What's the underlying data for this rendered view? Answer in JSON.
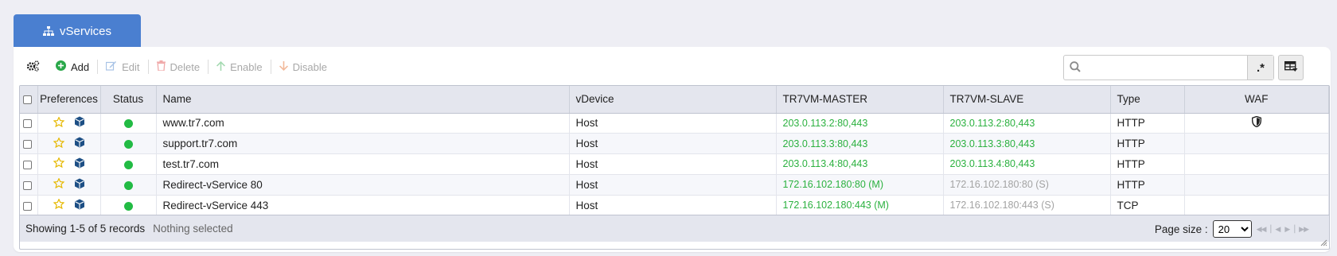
{
  "tab": {
    "label": "vServices"
  },
  "toolbar": {
    "add": "Add",
    "edit": "Edit",
    "delete": "Delete",
    "enable": "Enable",
    "disable": "Disable"
  },
  "search": {
    "value": "",
    "regex_label": ".*"
  },
  "columns": {
    "preferences": "Preferences",
    "status": "Status",
    "name": "Name",
    "vdevice": "vDevice",
    "master": "TR7VM-MASTER",
    "slave": "TR7VM-SLAVE",
    "type": "Type",
    "waf": "WAF"
  },
  "rows": [
    {
      "name": "www.tr7.com",
      "vdevice": "Host",
      "master": "203.0.113.2:80,443",
      "slave": "203.0.113.2:80,443",
      "type": "HTTP",
      "waf": true
    },
    {
      "name": "support.tr7.com",
      "vdevice": "Host",
      "master": "203.0.113.3:80,443",
      "slave": "203.0.113.3:80,443",
      "type": "HTTP",
      "waf": false
    },
    {
      "name": "test.tr7.com",
      "vdevice": "Host",
      "master": "203.0.113.4:80,443",
      "slave": "203.0.113.4:80,443",
      "type": "HTTP",
      "waf": false
    },
    {
      "name": "Redirect-vService 80",
      "vdevice": "Host",
      "master": "172.16.102.180:80 (M)",
      "slave": "172.16.102.180:80 (S)",
      "type": "HTTP",
      "waf": false
    },
    {
      "name": "Redirect-vService 443",
      "vdevice": "Host",
      "master": "172.16.102.180:443 (M)",
      "slave": "172.16.102.180:443 (S)",
      "type": "TCP",
      "waf": false
    }
  ],
  "footer": {
    "records": "Showing 1-5 of 5 records",
    "selection": "Nothing selected",
    "page_size_label": "Page size :",
    "page_size": "20"
  },
  "colors": {
    "accent": "#4a7fd0",
    "status_green": "#22bb44",
    "ip_green": "#2bb13f",
    "ip_grey": "#a3a3a3"
  }
}
